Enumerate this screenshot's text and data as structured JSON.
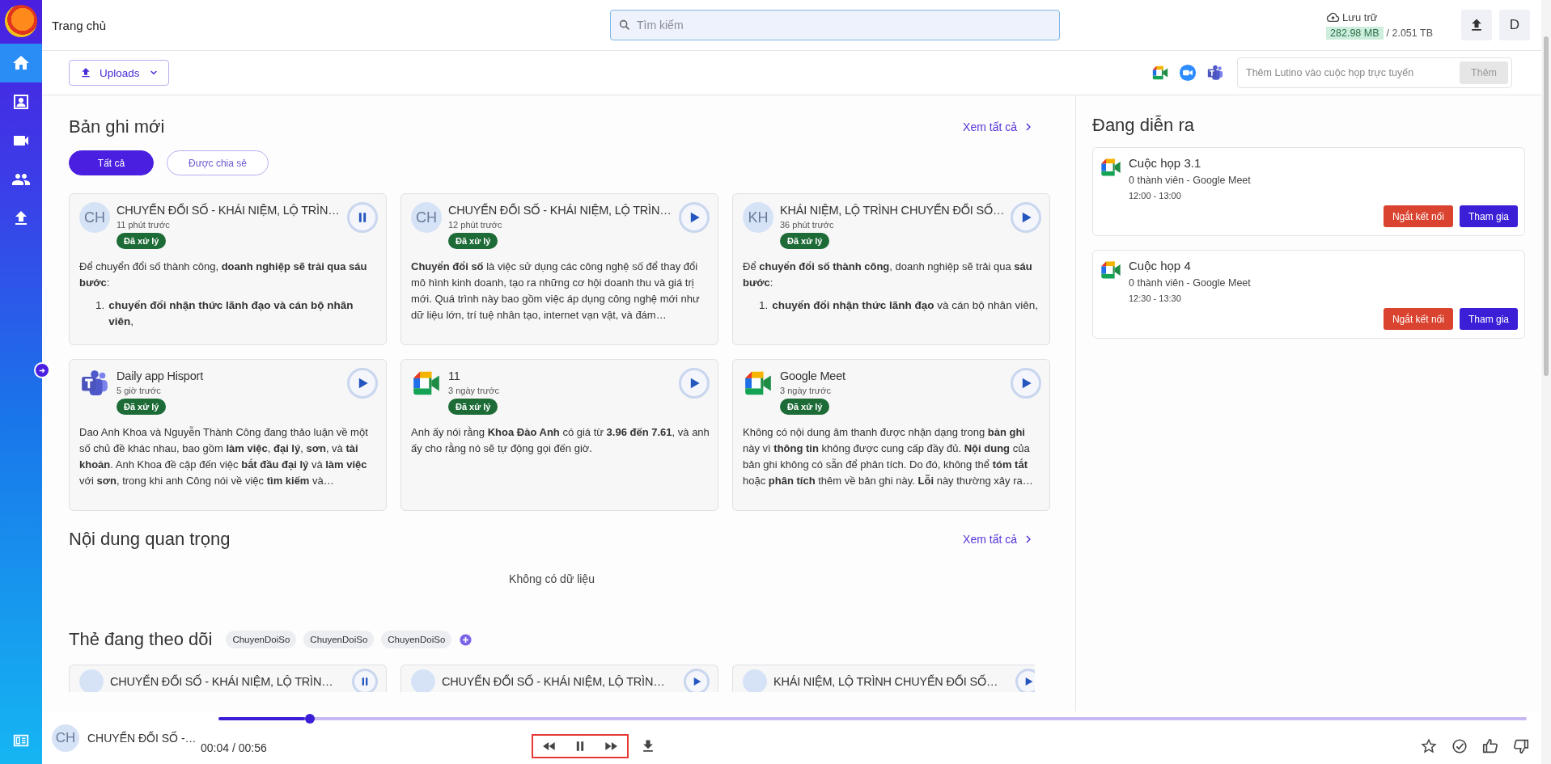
{
  "sidebar": {
    "items": [
      {
        "selected": true
      },
      {
        "selected": false
      },
      {
        "selected": false
      },
      {
        "selected": false
      },
      {
        "selected": false
      }
    ]
  },
  "topbar": {
    "title": "Trang chủ",
    "search": {
      "placeholder": "Tìm kiếm"
    },
    "storage": {
      "label": "Lưu trữ",
      "used": "282.98 MB",
      "total": "/ 2.051 TB"
    },
    "avatar": "D"
  },
  "toolbar": {
    "uploads_button": "Uploads",
    "meeting_input": {
      "placeholder": "Thêm Lutino vào cuộc họp trực tuyến"
    },
    "add_button": {
      "label": "Thêm",
      "disabled": true
    }
  },
  "recent": {
    "title": "Bản ghi mới",
    "see_all": "Xem tất cả",
    "filters": [
      {
        "label": "Tất cả",
        "selected": true
      },
      {
        "label": "Được chia sẻ",
        "selected": false
      }
    ],
    "cards": [
      {
        "kind": "avatar",
        "initials": "CH",
        "title": "CHUYỂN ĐỔI SỐ - KHÁI NIỆM, LỘ TRÌN…",
        "time": "11 phút trước",
        "status": "Đã xử lý",
        "playing": true,
        "body": "Để chuyển đổi số thành công, **doanh nghiệp sẽ trải qua sáu bước**:",
        "list": [
          {
            "number": "1.",
            "text": "**chuyển đổi nhận thức lãnh đạo và cán bộ nhân viên**,"
          }
        ]
      },
      {
        "kind": "avatar",
        "initials": "CH",
        "title": "CHUYỂN ĐỔI SỐ - KHÁI NIỆM, LỘ TRÌN…",
        "time": "12 phút trước",
        "status": "Đã xử lý",
        "playing": false,
        "body": "**Chuyển đổi số** là việc sử dụng các công nghệ số để thay đổi mô hình kinh doanh, tạo ra những cơ hội doanh thu và giá trị mới. Quá trình này bao gồm việc áp dụng công nghệ mới như dữ liệu lớn, trí tuệ nhân tạo, internet vạn vật, và đám…"
      },
      {
        "kind": "avatar",
        "initials": "KH",
        "title": "KHÁI NIỆM, LỘ TRÌNH CHUYỂN ĐỔI SỐ…",
        "time": "36 phút trước",
        "status": "Đã xử lý",
        "playing": false,
        "body": "Để **chuyển đổi số thành công**, doanh nghiệp sẽ trải qua **sáu bước**:",
        "list": [
          {
            "number": "1.",
            "text": "**chuyển đổi nhận thức lãnh đạo** và cán bộ nhân viên,"
          }
        ]
      },
      {
        "kind": "teams",
        "title": "Daily app Hisport",
        "time": "5 giờ trước",
        "status": "Đã xử lý",
        "playing": false,
        "body": "Dao Anh Khoa và Nguyễn Thành Công đang thảo luận về một số chủ đề khác nhau, bao gồm **làm việc**, **đại lý**, **sơn**, và **tài khoản**. Anh Khoa đề cập đến việc **bắt đầu đại lý** và **làm việc** với **sơn**, trong khi anh Công nói về việc **tìm kiếm** và…"
      },
      {
        "kind": "meet",
        "title": "11",
        "time": "3 ngày trước",
        "status": "Đã xử lý",
        "playing": false,
        "body": "Anh ấy nói rằng **Khoa Đào Anh** có giá từ **3.96 đến 7.61**, và anh ấy cho rằng nó sẽ tự động gọi đến giờ."
      },
      {
        "kind": "meet",
        "title": "Google Meet",
        "time": "3 ngày trước",
        "status": "Đã xử lý",
        "playing": false,
        "body": "Không có nội dung âm thanh được nhận dạng trong **bản ghi** này vì **thông tin** không được cung cấp đầy đủ. **Nội dung** của bản ghi không có sẵn để phân tích. Do đó, không thể **tóm tắt** hoặc **phân tích** thêm về bản ghi này. **Lỗi** này thường xảy ra…"
      }
    ]
  },
  "important": {
    "title": "Nội dung quan trọng",
    "see_all": "Xem tất cả",
    "empty": "Không có dữ liệu"
  },
  "tags": {
    "title": "Thẻ đang theo dõi",
    "items": [
      "ChuyenDoiSo",
      "ChuyenDoiSo",
      "ChuyenDoiSo"
    ],
    "cards": [
      {
        "title": "CHUYỂN ĐỔI SỐ - KHÁI NIỆM, LỘ TRÌN…",
        "playing": true
      },
      {
        "title": "CHUYỂN ĐỔI SỐ - KHÁI NIỆM, LỘ TRÌN…",
        "playing": false
      },
      {
        "title": "KHÁI NIỆM, LỘ TRÌNH CHUYỂN ĐỔI SỐ…",
        "playing": false
      }
    ]
  },
  "live": {
    "title": "Đang diễn ra",
    "meetings": [
      {
        "title": "Cuộc họp 3.1",
        "subtitle": "0 thành viên - Google Meet",
        "time": "12:00 - 13:00",
        "disconnect": "Ngắt kết nối",
        "join": "Tham gia"
      },
      {
        "title": "Cuộc họp 4",
        "subtitle": "0 thành viên - Google Meet",
        "time": "12:30 - 13:30",
        "disconnect": "Ngắt kết nối",
        "join": "Tham gia"
      }
    ]
  },
  "player": {
    "initials": "CH",
    "title": "CHUYỂN ĐỔI SỐ -…",
    "time": "00:04 / 00:56",
    "level": 0.07,
    "playing": true
  }
}
